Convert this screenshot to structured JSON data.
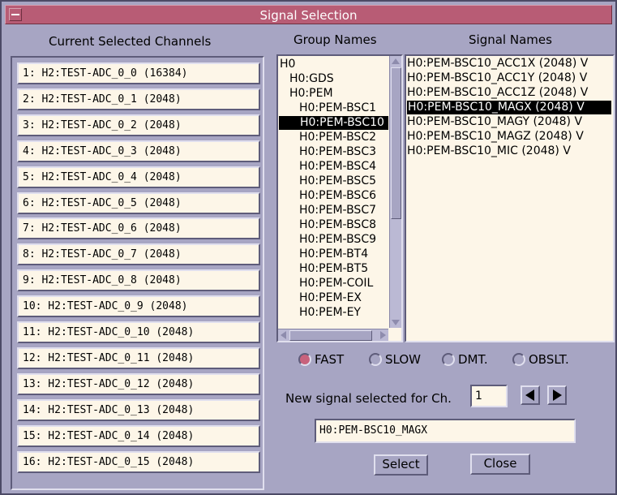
{
  "window": {
    "title": "Signal Selection"
  },
  "channels": {
    "header": "Current Selected Channels",
    "items": [
      "1: H2:TEST-ADC_0_0 (16384)",
      "2: H2:TEST-ADC_0_1 (2048)",
      "3: H2:TEST-ADC_0_2 (2048)",
      "4: H2:TEST-ADC_0_3 (2048)",
      "5: H2:TEST-ADC_0_4 (2048)",
      "6: H2:TEST-ADC_0_5 (2048)",
      "7: H2:TEST-ADC_0_6 (2048)",
      "8: H2:TEST-ADC_0_7 (2048)",
      "9: H2:TEST-ADC_0_8 (2048)",
      "10: H2:TEST-ADC_0_9 (2048)",
      "11: H2:TEST-ADC_0_10 (2048)",
      "12: H2:TEST-ADC_0_11 (2048)",
      "13: H2:TEST-ADC_0_12 (2048)",
      "14: H2:TEST-ADC_0_13 (2048)",
      "15: H2:TEST-ADC_0_14 (2048)",
      "16: H2:TEST-ADC_0_15 (2048)"
    ]
  },
  "groups": {
    "header": "Group Names",
    "items": [
      {
        "label": "H0",
        "level": 0
      },
      {
        "label": "H0:GDS",
        "level": 1
      },
      {
        "label": "H0:PEM",
        "level": 1
      },
      {
        "label": "H0:PEM-BSC1",
        "level": 2
      },
      {
        "label": "H0:PEM-BSC10",
        "level": 2,
        "selected": true
      },
      {
        "label": "H0:PEM-BSC2",
        "level": 2
      },
      {
        "label": "H0:PEM-BSC3",
        "level": 2
      },
      {
        "label": "H0:PEM-BSC4",
        "level": 2
      },
      {
        "label": "H0:PEM-BSC5",
        "level": 2
      },
      {
        "label": "H0:PEM-BSC6",
        "level": 2
      },
      {
        "label": "H0:PEM-BSC7",
        "level": 2
      },
      {
        "label": "H0:PEM-BSC8",
        "level": 2
      },
      {
        "label": "H0:PEM-BSC9",
        "level": 2
      },
      {
        "label": "H0:PEM-BT4",
        "level": 2
      },
      {
        "label": "H0:PEM-BT5",
        "level": 2
      },
      {
        "label": "H0:PEM-COIL",
        "level": 2
      },
      {
        "label": "H0:PEM-EX",
        "level": 2
      },
      {
        "label": "H0:PEM-EY",
        "level": 2
      }
    ]
  },
  "signals": {
    "header": "Signal Names",
    "items": [
      {
        "label": "H0:PEM-BSC10_ACC1X  (2048) V"
      },
      {
        "label": "H0:PEM-BSC10_ACC1Y  (2048) V"
      },
      {
        "label": "H0:PEM-BSC10_ACC1Z  (2048) V"
      },
      {
        "label": "H0:PEM-BSC10_MAGX  (2048) V",
        "selected": true
      },
      {
        "label": "H0:PEM-BSC10_MAGY  (2048) V"
      },
      {
        "label": "H0:PEM-BSC10_MAGZ  (2048) V"
      },
      {
        "label": "H0:PEM-BSC10_MIC  (2048) V"
      }
    ]
  },
  "rates": {
    "options": [
      "FAST",
      "SLOW",
      "DMT.",
      "OBSLT."
    ],
    "selected": "FAST"
  },
  "new_signal": {
    "label": "New signal selected for Ch.",
    "channel": "1",
    "value": "H0:PEM-BSC10_MAGX"
  },
  "buttons": {
    "select": "Select",
    "close": "Close"
  },
  "colors": {
    "title_bar": "#b85c75",
    "radio_on": "#c8627c",
    "list_bg": "#fdf6e8"
  }
}
